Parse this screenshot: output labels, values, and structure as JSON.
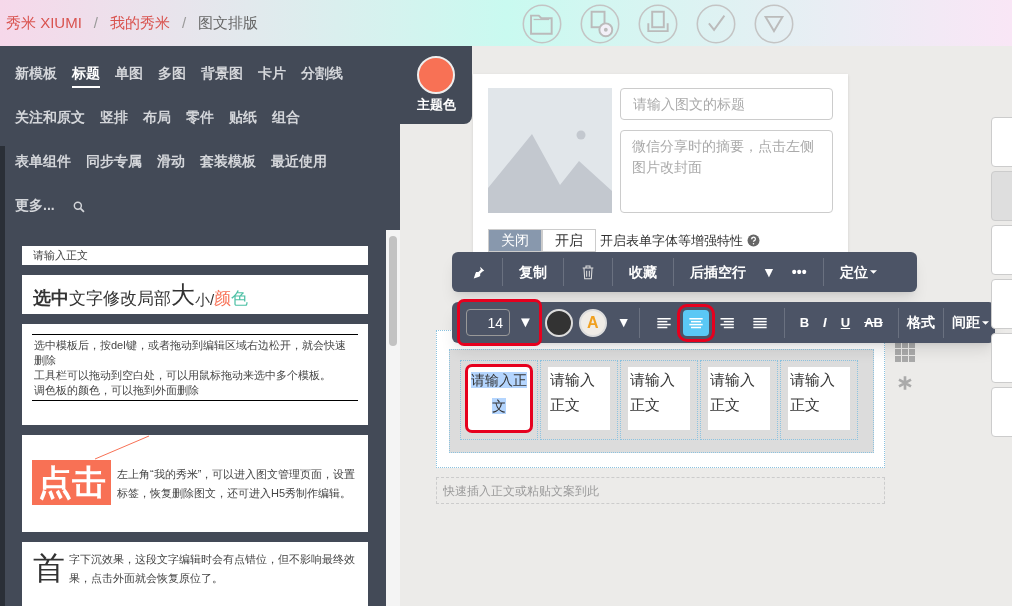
{
  "header": {
    "breadcrumbs": [
      {
        "label": "秀米 XIUMI",
        "kind": "link"
      },
      {
        "label": "我的秀米",
        "kind": "link"
      },
      {
        "label": "图文排版",
        "kind": "current"
      }
    ],
    "separators": [
      "/",
      "/"
    ]
  },
  "category_rows": [
    [
      {
        "label": "新模板",
        "selected": false
      },
      {
        "label": "标题",
        "selected": true
      },
      {
        "label": "单图",
        "selected": false
      },
      {
        "label": "多图",
        "selected": false
      },
      {
        "label": "背景图",
        "selected": false
      },
      {
        "label": "卡片",
        "selected": false
      },
      {
        "label": "分割线",
        "selected": false
      }
    ],
    [
      {
        "label": "关注和原文",
        "selected": false
      },
      {
        "label": "竖排",
        "selected": false
      },
      {
        "label": "布局",
        "selected": false
      },
      {
        "label": "零件",
        "selected": false
      },
      {
        "label": "贴纸",
        "selected": false
      },
      {
        "label": "组合",
        "selected": false
      }
    ],
    [
      {
        "label": "表单组件",
        "selected": false
      },
      {
        "label": "同步专属",
        "selected": false
      },
      {
        "label": "滑动",
        "selected": false
      },
      {
        "label": "套装模板",
        "selected": false
      },
      {
        "label": "最近使用",
        "selected": false
      }
    ],
    [
      {
        "label": "更多...",
        "selected": false
      }
    ]
  ],
  "theme_color": {
    "label": "主题色",
    "color": "#f87155"
  },
  "templates": [
    {
      "kind": "plain",
      "text": "请输入正文"
    },
    {
      "kind": "styled",
      "segments": [
        {
          "text": "选中",
          "kind": "bold",
          "color": "#333333"
        },
        {
          "text": "文字修改局部",
          "kind": "normal",
          "color": "#333333"
        },
        {
          "text": "大",
          "kind": "large",
          "color": "#333333"
        },
        {
          "text": "小/",
          "kind": "small",
          "color": "#333333"
        },
        {
          "text": "颜",
          "kind": "normal",
          "color": "#f87155"
        },
        {
          "text": "色",
          "kind": "normal",
          "color": "#4fc1a6"
        }
      ]
    },
    {
      "kind": "notes",
      "lines": [
        "选中模板后，按del键，或者拖动到编辑区域右边松开，就会快速删除",
        "工具栏可以拖动到空白处，可以用鼠标拖动来选中多个模板。",
        "调色板的颜色，可以拖到外面删除"
      ]
    },
    {
      "kind": "callout",
      "badge": "点击",
      "text": "左上角“我的秀米”，可以进入图文管理页面，设置标签，恢复删除图文，还可进入H5秀制作编辑。"
    },
    {
      "kind": "dropcap",
      "cap": "首",
      "text": "字下沉效果，这段文字编辑时会有点错位，但不影响最终效果，点击外面就会恢复原位了。"
    }
  ],
  "editor": {
    "title_field": {
      "placeholder": "请输入图文的标题"
    },
    "summary_field": {
      "placeholder": "微信分享时的摘要，点击左侧图片改封面"
    },
    "toggle": [
      {
        "label": "关闭",
        "selected": true
      },
      {
        "label": "开启",
        "selected": false
      }
    ],
    "toggle_label": "开启表单字体等增强特性"
  },
  "block_toolbar": [
    {
      "kind": "pin"
    },
    {
      "kind": "text",
      "label": "复制"
    },
    {
      "kind": "trash"
    },
    {
      "kind": "text",
      "label": "收藏"
    },
    {
      "kind": "text",
      "label": "后插空行"
    },
    {
      "kind": "glyph",
      "label": "▼"
    },
    {
      "kind": "glyph",
      "label": "•••"
    },
    {
      "kind": "menu",
      "label": "定位"
    }
  ],
  "format_toolbar": {
    "font_size": {
      "value": "14",
      "caret": "▼",
      "highlighted": true
    },
    "highlight_letter": "A",
    "highlight_caret": "▼",
    "aligns": [
      {
        "kind": "left",
        "selected": false,
        "highlighted": false
      },
      {
        "kind": "center",
        "selected": true,
        "highlighted": true
      },
      {
        "kind": "right",
        "selected": false,
        "highlighted": false
      },
      {
        "kind": "justify",
        "selected": false,
        "highlighted": false
      }
    ],
    "styles": [
      {
        "kind": "bold",
        "label": "B"
      },
      {
        "kind": "italic",
        "label": "I"
      },
      {
        "kind": "underline",
        "label": "U"
      },
      {
        "kind": "strike",
        "label": "AB"
      }
    ],
    "menus": [
      {
        "label": "格式",
        "dropdown": false
      },
      {
        "label": "间距",
        "dropdown": true
      }
    ]
  },
  "canvas": {
    "cells": [
      {
        "text": "请输入正文",
        "selected": true
      },
      {
        "text": "请输入正文",
        "selected": false
      },
      {
        "text": "请输入正文",
        "selected": false
      },
      {
        "text": "请输入正文",
        "selected": false
      },
      {
        "text": "请输入正文",
        "selected": false
      }
    ],
    "quick_insert": {
      "placeholder": "快速插入正文或粘贴文案到此"
    }
  },
  "side_buttons": [
    {
      "disabled": false
    },
    {
      "disabled": true
    },
    {
      "disabled": false
    },
    {
      "disabled": false
    },
    {
      "disabled": false
    },
    {
      "disabled": false
    }
  ]
}
